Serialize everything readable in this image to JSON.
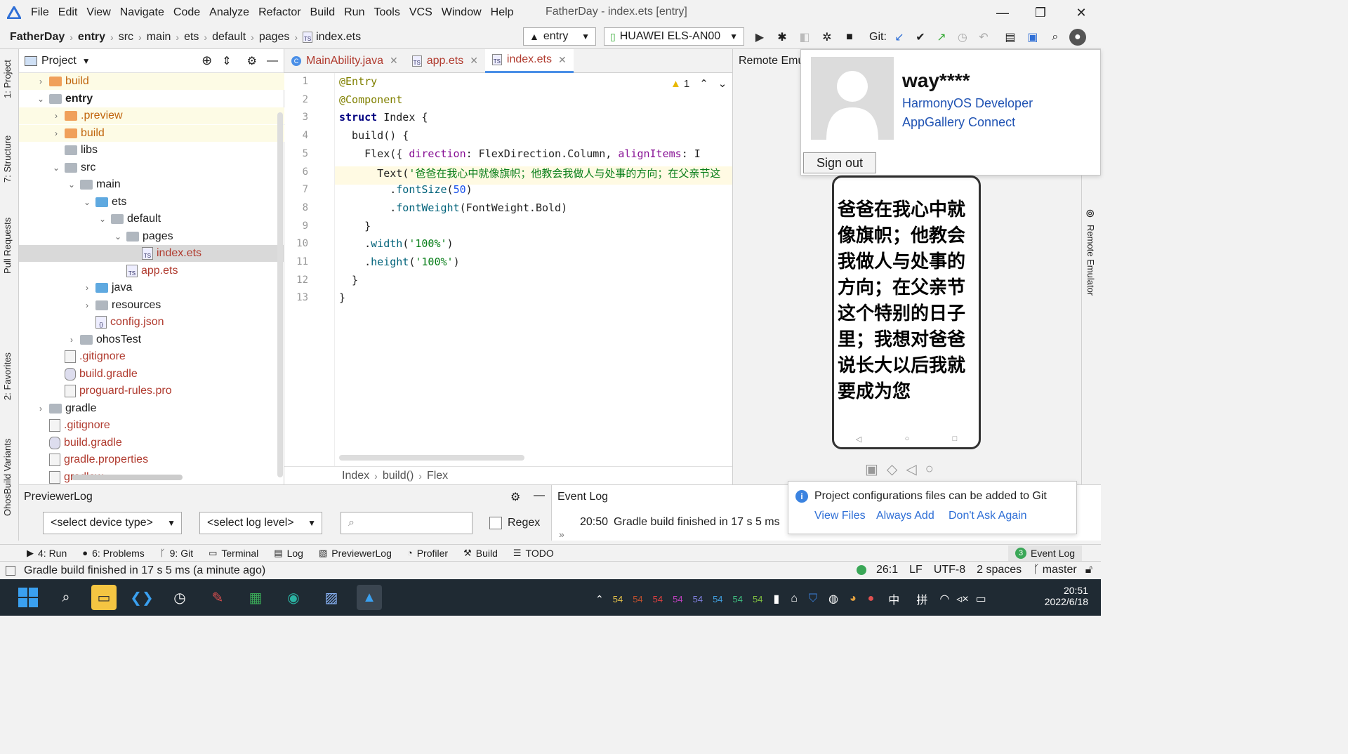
{
  "menu": [
    "File",
    "Edit",
    "View",
    "Navigate",
    "Code",
    "Analyze",
    "Refactor",
    "Build",
    "Run",
    "Tools",
    "VCS",
    "Window",
    "Help"
  ],
  "window_title": "FatherDay - index.ets [entry]",
  "window_controls": {
    "minimize": "—",
    "restore": "❐",
    "close": "✕"
  },
  "breadcrumbs": [
    "FatherDay",
    "entry",
    "src",
    "main",
    "ets",
    "default",
    "pages",
    "index.ets"
  ],
  "run_config": "entry",
  "device": "HUAWEI ELS-AN00",
  "git_label": "Git:",
  "left_tabs": [
    "1: Project",
    "7: Structure",
    "Pull Requests",
    "2: Favorites",
    "OhosBuild Variants"
  ],
  "project": {
    "header": "Project",
    "tree": [
      {
        "label": "build",
        "depth": 1,
        "arrow": "›",
        "icon": "folder-orange",
        "color": "orange"
      },
      {
        "label": "entry",
        "depth": 1,
        "arrow": "⌄",
        "icon": "folder-module",
        "bold": true
      },
      {
        "label": ".preview",
        "depth": 2,
        "arrow": "›",
        "icon": "folder-orange",
        "color": "orange"
      },
      {
        "label": "build",
        "depth": 2,
        "arrow": "›",
        "icon": "folder-orange",
        "color": "orange"
      },
      {
        "label": "libs",
        "depth": 2,
        "arrow": "",
        "icon": "folder"
      },
      {
        "label": "src",
        "depth": 2,
        "arrow": "⌄",
        "icon": "folder"
      },
      {
        "label": "main",
        "depth": 3,
        "arrow": "⌄",
        "icon": "folder"
      },
      {
        "label": "ets",
        "depth": 4,
        "arrow": "⌄",
        "icon": "folder-blue"
      },
      {
        "label": "default",
        "depth": 5,
        "arrow": "⌄",
        "icon": "folder"
      },
      {
        "label": "pages",
        "depth": 6,
        "arrow": "⌄",
        "icon": "folder"
      },
      {
        "label": "index.ets",
        "depth": 7,
        "arrow": "",
        "icon": "ts-file",
        "color": "red",
        "selected": true
      },
      {
        "label": "app.ets",
        "depth": 6,
        "arrow": "",
        "icon": "ts-file",
        "color": "red"
      },
      {
        "label": "java",
        "depth": 4,
        "arrow": "›",
        "icon": "folder-blue"
      },
      {
        "label": "resources",
        "depth": 4,
        "arrow": "›",
        "icon": "folder"
      },
      {
        "label": "config.json",
        "depth": 4,
        "arrow": "",
        "icon": "json-file",
        "color": "red"
      },
      {
        "label": "ohosTest",
        "depth": 3,
        "arrow": "›",
        "icon": "folder"
      },
      {
        "label": ".gitignore",
        "depth": 2,
        "arrow": "",
        "icon": "text-file",
        "color": "red"
      },
      {
        "label": "build.gradle",
        "depth": 2,
        "arrow": "",
        "icon": "gradle-file",
        "color": "red"
      },
      {
        "label": "proguard-rules.pro",
        "depth": 2,
        "arrow": "",
        "icon": "text-file",
        "color": "red"
      },
      {
        "label": "gradle",
        "depth": 1,
        "arrow": "›",
        "icon": "folder"
      },
      {
        "label": ".gitignore",
        "depth": 1,
        "arrow": "",
        "icon": "text-file",
        "color": "red"
      },
      {
        "label": "build.gradle",
        "depth": 1,
        "arrow": "",
        "icon": "gradle-file",
        "color": "red"
      },
      {
        "label": "gradle.properties",
        "depth": 1,
        "arrow": "",
        "icon": "text-file",
        "color": "red"
      },
      {
        "label": "gradlew",
        "depth": 1,
        "arrow": "",
        "icon": "text-file",
        "color": "red"
      }
    ]
  },
  "editor": {
    "tabs": [
      {
        "label": "MainAbility.java",
        "active": false
      },
      {
        "label": "app.ets",
        "active": false
      },
      {
        "label": "index.ets",
        "active": true
      }
    ],
    "warnings": "1",
    "lines": [
      "@Entry",
      "@Component",
      "struct Index {",
      "  build() {",
      "    Flex({ direction: FlexDirection.Column, alignItems: I",
      "      Text('爸爸在我心中就像旗帜；他教会我做人与处事的方向；在父亲节这",
      "        .fontSize(50)",
      "        .fontWeight(FontWeight.Bold)",
      "    }",
      "    .width('100%')",
      "    .height('100%')",
      "  }",
      "}"
    ],
    "breadcrumb": [
      "Index",
      "build()",
      "Flex"
    ]
  },
  "remote_emulator": {
    "title": "Remote Emu",
    "side_label": "Remote Emulator",
    "phone_text": "爸爸在我心中就像旗帜；他教会我做人与处事的方向；在父亲节这个特别的日子里；我想对爸爸说长大以后我就要成为您",
    "nav": [
      "◁",
      "○",
      "□"
    ]
  },
  "account": {
    "name": "way****",
    "links": [
      "HarmonyOS Developer",
      "AppGallery Connect"
    ],
    "sign_out": "Sign out"
  },
  "previewer_log": {
    "title": "PreviewerLog",
    "device_select": "<select device type>",
    "level_select": "<select log level>",
    "search_placeholder": "",
    "regex": "Regex"
  },
  "event_log": {
    "title": "Event Log",
    "entries": [
      {
        "time": "20:50",
        "text": "Gradle build finished in 17 s 5 ms"
      }
    ]
  },
  "notification": {
    "text": "Project configurations files can be added to Git",
    "actions": [
      "View Files",
      "Always Add",
      "Don't Ask Again"
    ]
  },
  "tool_windows": [
    {
      "label": "4: Run",
      "icon": "run-icon"
    },
    {
      "label": "6: Problems",
      "icon": "problems-icon"
    },
    {
      "label": "9: Git",
      "icon": "git-icon"
    },
    {
      "label": "Terminal",
      "icon": "terminal-icon"
    },
    {
      "label": "Log",
      "icon": "log-icon"
    },
    {
      "label": "PreviewerLog",
      "icon": "previewer-icon"
    },
    {
      "label": "Profiler",
      "icon": "profiler-icon"
    },
    {
      "label": "Build",
      "icon": "build-icon"
    },
    {
      "label": "TODO",
      "icon": "todo-icon"
    }
  ],
  "event_log_badge": {
    "count": "3",
    "label": "Event Log"
  },
  "status": {
    "message": "Gradle build finished in 17 s 5 ms (a minute ago)",
    "position": "26:1",
    "line_sep": "LF",
    "encoding": "UTF-8",
    "indent": "2 spaces",
    "branch": "master"
  },
  "taskbar": {
    "tray_numbers": [
      "54",
      "54",
      "54",
      "54",
      "54",
      "54",
      "54",
      "54"
    ],
    "ime": [
      "中",
      "拼"
    ],
    "time": "20:51",
    "date": "2022/6/18"
  },
  "colors": {
    "accent": "#4a8fe7",
    "link": "#2053b3",
    "file_red": "#b03a2e",
    "folder_orange": "#f0a05a"
  }
}
